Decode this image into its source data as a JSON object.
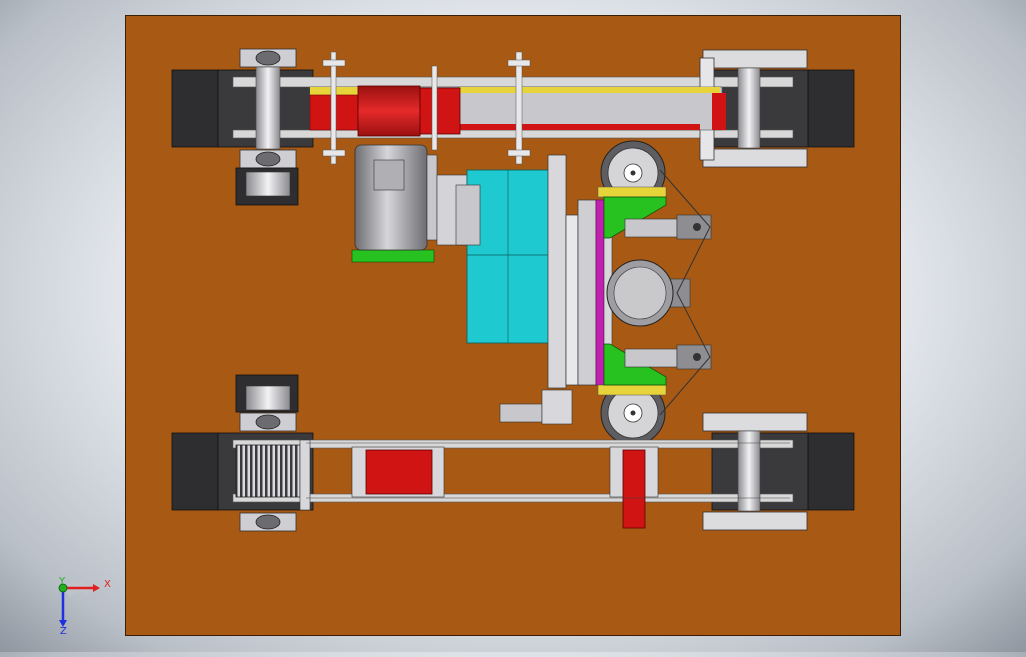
{
  "viewport": {
    "background_top": "#f4f6f9",
    "background_edge": "#8f969f"
  },
  "colors": {
    "base_plate": "#a85a14",
    "base_plate_edge": "#3a1e06",
    "track_dark": "#2e2e30",
    "rail_light": "#d8d8d8",
    "steel": "#bfbfc4",
    "red_part": "#d01414",
    "yellow_stripe": "#e6d43a",
    "cyan_block": "#1ec9cf",
    "green_part": "#27c21f",
    "magenta_strip": "#c21fb0",
    "motor_grey": "#9d9da2"
  },
  "axis_triad": {
    "x_label": "X",
    "y_label": "Y",
    "z_label": "Z",
    "x_color": "#e02020",
    "y_color": "#20b020",
    "z_color": "#2030e0"
  }
}
